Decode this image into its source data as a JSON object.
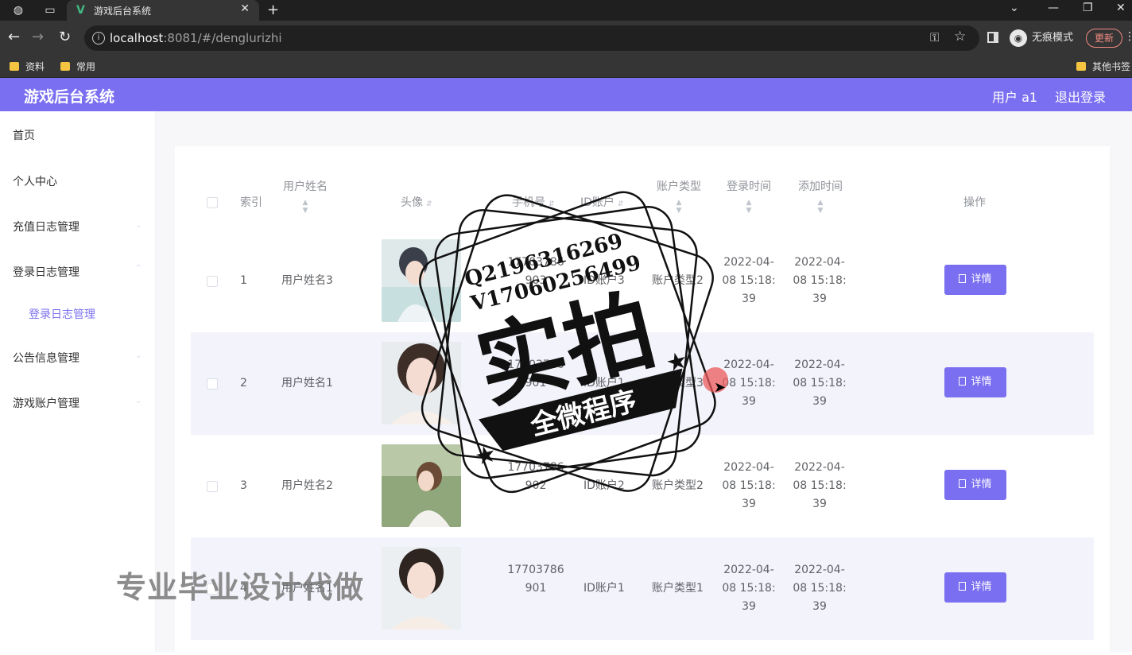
{
  "browser": {
    "tab_title": "游戏后台系统",
    "url_host": "localhost",
    "url_path": ":8081/#/denglurizhi",
    "incognito_label": "无痕模式",
    "update_label": "更新",
    "bookmarks": [
      "资料",
      "常用"
    ],
    "other_bookmarks": "其他书签"
  },
  "header": {
    "brand": "游戏后台系统",
    "user": "用户 a1",
    "logout": "退出登录"
  },
  "sidebar": {
    "items": [
      {
        "label": "首页"
      },
      {
        "label": "个人中心"
      },
      {
        "label": "充值日志管理"
      },
      {
        "label": "登录日志管理"
      },
      {
        "label": "登录日志管理"
      },
      {
        "label": "公告信息管理"
      },
      {
        "label": "游戏账户管理"
      }
    ]
  },
  "table": {
    "columns": [
      "索引",
      "用户姓名",
      "头像",
      "手机号",
      "ID账户",
      "账户类型",
      "登录时间",
      "添加时间",
      "操作"
    ],
    "rows": [
      {
        "index": "1",
        "name": "用户姓名3",
        "phone1": "17703786",
        "phone2": "903",
        "account": "ID账户3",
        "type": "账户类型2",
        "login1": "2022-04-",
        "login2": "08 15:18:",
        "login3": "39",
        "add1": "2022-04-",
        "add2": "08 15:18:",
        "add3": "39",
        "action": "详情"
      },
      {
        "index": "2",
        "name": "用户姓名1",
        "phone1": "17703786",
        "phone2": "901",
        "account": "ID账户1",
        "type": "账户类型3",
        "login1": "2022-04-",
        "login2": "08 15:18:",
        "login3": "39",
        "add1": "2022-04-",
        "add2": "08 15:18:",
        "add3": "39",
        "action": "详情"
      },
      {
        "index": "3",
        "name": "用户姓名2",
        "phone1": "17703786",
        "phone2": "902",
        "account": "ID账户2",
        "type": "账户类型2",
        "login1": "2022-04-",
        "login2": "08 15:18:",
        "login3": "39",
        "add1": "2022-04-",
        "add2": "08 15:18:",
        "add3": "39",
        "action": "详情"
      },
      {
        "index": "4",
        "name": "用户姓名1",
        "phone1": "17703786",
        "phone2": "901",
        "account": "ID账户1",
        "type": "账户类型1",
        "login1": "2022-04-",
        "login2": "08 15:18:",
        "login3": "39",
        "add1": "2022-04-",
        "add2": "08 15:18:",
        "add3": "39",
        "action": "详情"
      }
    ]
  },
  "watermark": {
    "line1": "Q2196316269",
    "line2": "V17060256499",
    "big": "实拍",
    "ribbon": "全微程序",
    "overlay": "专业毕业设计代做"
  },
  "colors": {
    "accent": "#7a6ff0",
    "chrome": "#353535"
  }
}
